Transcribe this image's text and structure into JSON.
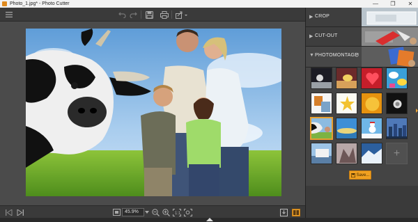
{
  "window": {
    "title": "Photo_1.jpg* - Photo Cutter",
    "minimize_glyph": "—",
    "maximize_glyph": "❐",
    "close_glyph": "✕"
  },
  "toolbar": {
    "menu_icon": "hamburger-icon",
    "undo_icon": "undo-icon",
    "redo_icon": "redo-icon",
    "save_icon": "floppy-icon",
    "print_icon": "printer-icon",
    "share_icon": "share-icon"
  },
  "bottom": {
    "zoom_value": "45.9%",
    "prev_icon": "prev-icon",
    "next_icon": "next-icon"
  },
  "panel": {
    "sections": [
      {
        "label": "CROP"
      },
      {
        "label": "CUT-OUT"
      },
      {
        "label": "PHOTOMONTAGE"
      }
    ],
    "save_label": "Save..."
  },
  "colors": {
    "accent": "#f0a020",
    "panel_bg": "#2f2f2f",
    "workspace_bg": "#4b4b4b"
  }
}
